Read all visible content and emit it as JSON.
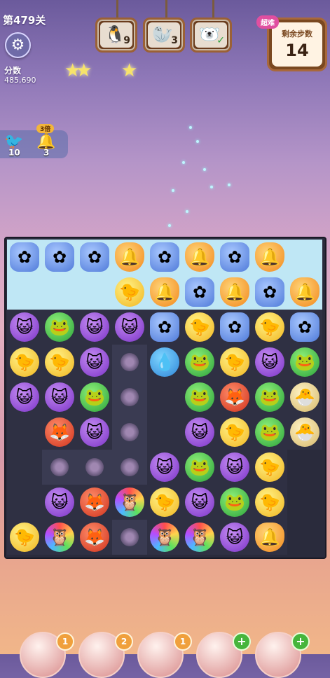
{
  "hud": {
    "level": "第479关",
    "score_label": "分数",
    "score_value": "485,690",
    "difficulty_badge": "超难",
    "moves_label": "剩余步数",
    "moves_value": "14",
    "stars": 2
  },
  "goals": [
    {
      "name": "penguin",
      "icon": "🐧",
      "count": "9"
    },
    {
      "name": "seal",
      "icon": "🦭",
      "count": "3"
    },
    {
      "name": "bear",
      "icon": "🐻‍❄️",
      "count": "✓"
    }
  ],
  "side_boosters": [
    {
      "name": "bird-booster",
      "icon": "🐦",
      "count": "10"
    },
    {
      "name": "bell-booster",
      "icon": "🔔",
      "count": "3",
      "multiplier": "3倍"
    }
  ],
  "board": {
    "rows": [
      [
        "hydra",
        "hydra",
        "hydra",
        "orange",
        "hydra",
        "orange",
        "hydra",
        "orange",
        "ice"
      ],
      [
        "ice",
        "ice",
        "ice",
        "yellow",
        "orange",
        "hydra",
        "orange",
        "hydra",
        "orange"
      ],
      [
        "purple",
        "green",
        "purple",
        "purple",
        "hydra",
        "yellow",
        "hydra",
        "yellow",
        "hydra"
      ],
      [
        "yellow",
        "yellow",
        "purple",
        "flower",
        "blue",
        "green",
        "yellow",
        "purple",
        "green"
      ],
      [
        "purple",
        "purple",
        "green",
        "flower",
        "dark",
        "green",
        "red",
        "green",
        "egg"
      ],
      [
        "dark",
        "red",
        "purple",
        "flower",
        "dark",
        "purple",
        "yellow",
        "green",
        "egg"
      ],
      [
        "dark",
        "flower",
        "flower",
        "flower",
        "purple",
        "green",
        "purple",
        "yellow",
        "none"
      ],
      [
        "dark",
        "purple",
        "red",
        "rainbow",
        "yellow",
        "purple",
        "green",
        "yellow",
        "none"
      ],
      [
        "yellow",
        "rainbow",
        "red",
        "flower",
        "rainbow",
        "rainbow",
        "purple",
        "orange",
        "none"
      ]
    ]
  },
  "bottom_boosters": [
    {
      "name": "booster-1",
      "count": "1",
      "plus": false
    },
    {
      "name": "booster-2",
      "count": "2",
      "plus": false
    },
    {
      "name": "booster-3",
      "count": "1",
      "plus": false
    },
    {
      "name": "booster-4",
      "count": "+",
      "plus": true
    },
    {
      "name": "booster-5",
      "count": "+",
      "plus": true
    }
  ]
}
